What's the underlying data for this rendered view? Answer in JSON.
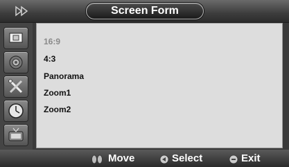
{
  "header": {
    "title": "Screen Form"
  },
  "menu": {
    "options": [
      {
        "label": "16:9",
        "selected": true
      },
      {
        "label": "4:3",
        "selected": false
      },
      {
        "label": "Panorama",
        "selected": false
      },
      {
        "label": "Zoom1",
        "selected": false
      },
      {
        "label": "Zoom2",
        "selected": false
      }
    ]
  },
  "sidebar": {
    "items": [
      {
        "icon": "picture-icon",
        "active": true
      },
      {
        "icon": "sound-icon",
        "active": false
      },
      {
        "icon": "setup-icon",
        "active": false
      },
      {
        "icon": "time-icon",
        "active": false
      },
      {
        "icon": "tv-icon",
        "active": false
      }
    ]
  },
  "footer": {
    "move_label": "Move",
    "select_label": "Select",
    "exit_label": "Exit"
  }
}
